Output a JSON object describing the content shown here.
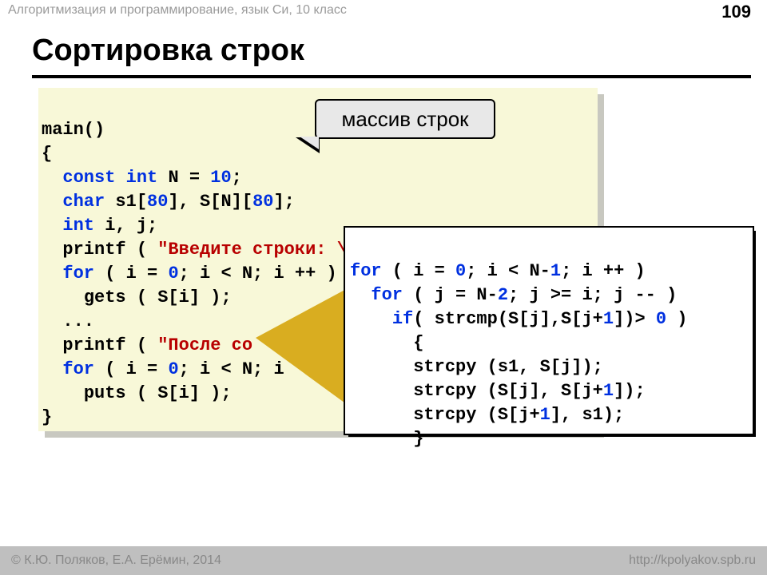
{
  "header": {
    "top": "Алгоритмизация и программирование, язык Си, 10 класс",
    "slide_number": "109"
  },
  "title": "Сортировка строк",
  "callout": "массив строк",
  "code_main": {
    "l1": "main()",
    "l2": "{",
    "l3_kw1": "const",
    "l3_kw2": "int",
    "l3_n": "N",
    "l3_eq": "=",
    "l3_v": "10",
    "l3_sc": ";",
    "l4_kw": "char",
    "l4_a": " s1[",
    "l4_80a": "80",
    "l4_b": "], S[N][",
    "l4_80b": "80",
    "l4_c": "];",
    "l5_kw": "int",
    "l5_rest": " i, j;",
    "l6_a": "printf ( ",
    "l6_s": "\"Введите строки: \\n\"",
    "l6_b": " );",
    "l7_kw": "for",
    "l7_a": " ( i = ",
    "l7_0": "0",
    "l7_b": "; i < N; i ++ )",
    "l8": "gets ( S[i] );",
    "l9": "...",
    "l10_a": "printf ( ",
    "l10_s": "\"После со",
    "l10_b": "",
    "l11_kw": "for",
    "l11_a": " ( i = ",
    "l11_0": "0",
    "l11_b": "; i < N; i",
    "l12": "puts ( S[i] );",
    "l13": "}"
  },
  "code_sort": {
    "l1_kw": "for",
    "l1_a": " ( i = ",
    "l1_0": "0",
    "l1_b": "; i < N-",
    "l1_1": "1",
    "l1_c": "; i ++ )",
    "l2_kw": "for",
    "l2_a": " ( j = N-",
    "l2_2": "2",
    "l2_b": "; j >= i; j -- )",
    "l3_kw": "if",
    "l3_a": "( strcmp(S[j],S[j+",
    "l3_1a": "1",
    "l3_b": "])> ",
    "l3_0": "0",
    "l3_c": " )",
    "l4": "{",
    "l5": "strcpy (s1, S[j]);",
    "l6a": "strcpy (S[j], S[j+",
    "l6_1": "1",
    "l6b": "]);",
    "l7a": "strcpy (S[j+",
    "l7_1": "1",
    "l7b": "], s1);",
    "l8": "}"
  },
  "footer": {
    "left": "© К.Ю. Поляков, Е.А. Ерёмин, 2014",
    "right": "http://kpolyakov.spb.ru"
  }
}
